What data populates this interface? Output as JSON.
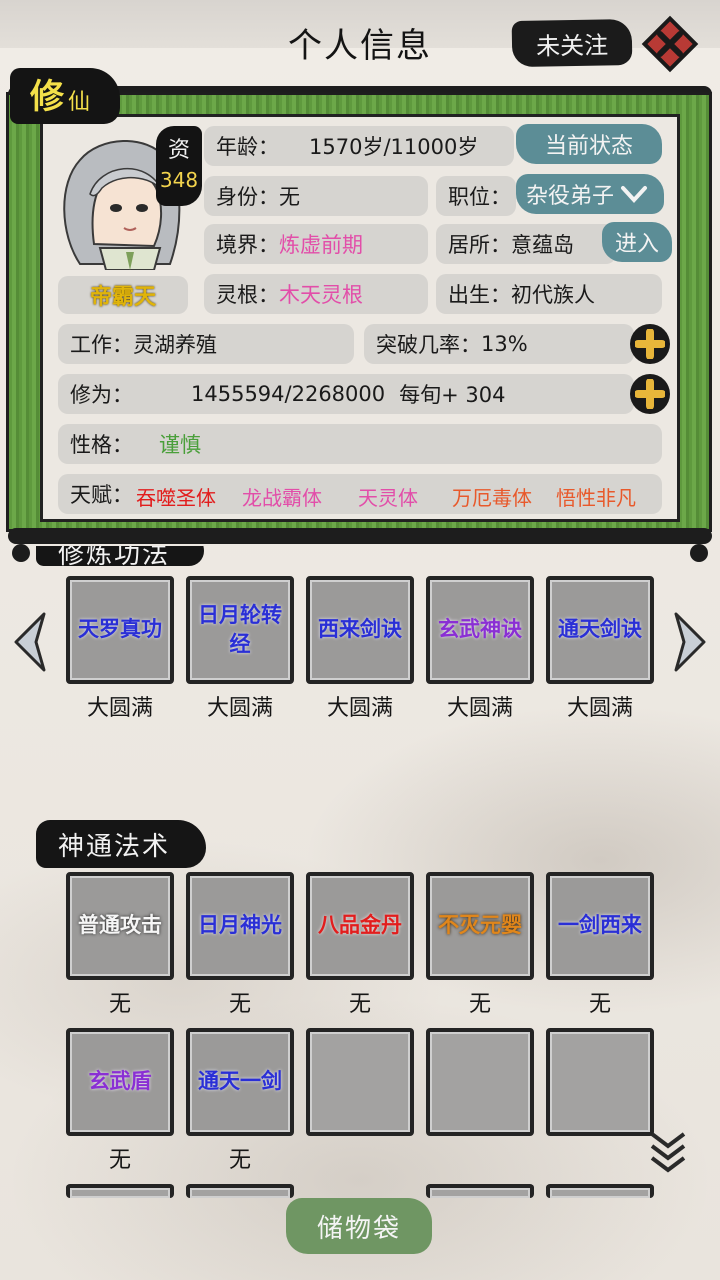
{
  "header": {
    "title": "个人信息",
    "follow_label": "未关注"
  },
  "profile": {
    "tag_big": "修",
    "tag_small": "仙",
    "aptitude_label": "资",
    "aptitude_value": "348",
    "name": "帝霸天",
    "age_label": "年龄：",
    "age_value": "1570岁/11000岁",
    "status_button": "当前状态",
    "identity_label": "身份：",
    "identity_value": "无",
    "position_label": "职位：",
    "position_value": "杂役弟子",
    "realm_label": "境界：",
    "realm_value": "炼虚前期",
    "residence_label": "居所：",
    "residence_value": "意蕴岛",
    "enter_button": "进入",
    "root_label": "灵根：",
    "root_value": "木天灵根",
    "birth_label": "出生：",
    "birth_value": "初代族人",
    "work_label": "工作：",
    "work_value": "灵湖养殖",
    "breakthrough_label": "突破几率：",
    "breakthrough_value": "13%",
    "cultivation_label": "修为：",
    "cultivation_value": "1455594/2268000",
    "cultivation_rate": "每旬+ 304",
    "personality_label": "性格：",
    "personality_value": "谨慎",
    "talent_label": "天赋：",
    "talents": [
      {
        "name": "吞噬圣体",
        "color": "#e21d1d"
      },
      {
        "name": "龙战霸体",
        "color": "#e24ea9"
      },
      {
        "name": "天灵体",
        "color": "#e24ea9"
      },
      {
        "name": "万厄毒体",
        "color": "#e8592b"
      },
      {
        "name": "悟性非凡",
        "color": "#e8592b"
      }
    ]
  },
  "techniques": {
    "title": "修炼功法",
    "items": [
      {
        "name": "天罗真功",
        "level": "大圆满",
        "tone": "blue"
      },
      {
        "name": "日月轮转经",
        "level": "大圆满",
        "tone": "blue"
      },
      {
        "name": "西来剑诀",
        "level": "大圆满",
        "tone": "blue"
      },
      {
        "name": "玄武神诀",
        "level": "大圆满",
        "tone": "purple"
      },
      {
        "name": "通天剑诀",
        "level": "大圆满",
        "tone": "blue"
      }
    ]
  },
  "spells": {
    "title": "神通法术",
    "items": [
      {
        "name": "普通攻击",
        "level": "无",
        "tone": "white"
      },
      {
        "name": "日月神光",
        "level": "无",
        "tone": "blue"
      },
      {
        "name": "八品金丹",
        "level": "无",
        "tone": "red"
      },
      {
        "name": "不灭元婴",
        "level": "无",
        "tone": "orange"
      },
      {
        "name": "一剑西来",
        "level": "无",
        "tone": "blue"
      },
      {
        "name": "玄武盾",
        "level": "无",
        "tone": "purple"
      },
      {
        "name": "通天一剑",
        "level": "无",
        "tone": "blue"
      }
    ]
  },
  "footer": {
    "bag_label": "储物袋"
  },
  "colors": {
    "scroll_green": "#6ca849",
    "teal": "#5c8d96",
    "bag_green": "#6f9663"
  }
}
